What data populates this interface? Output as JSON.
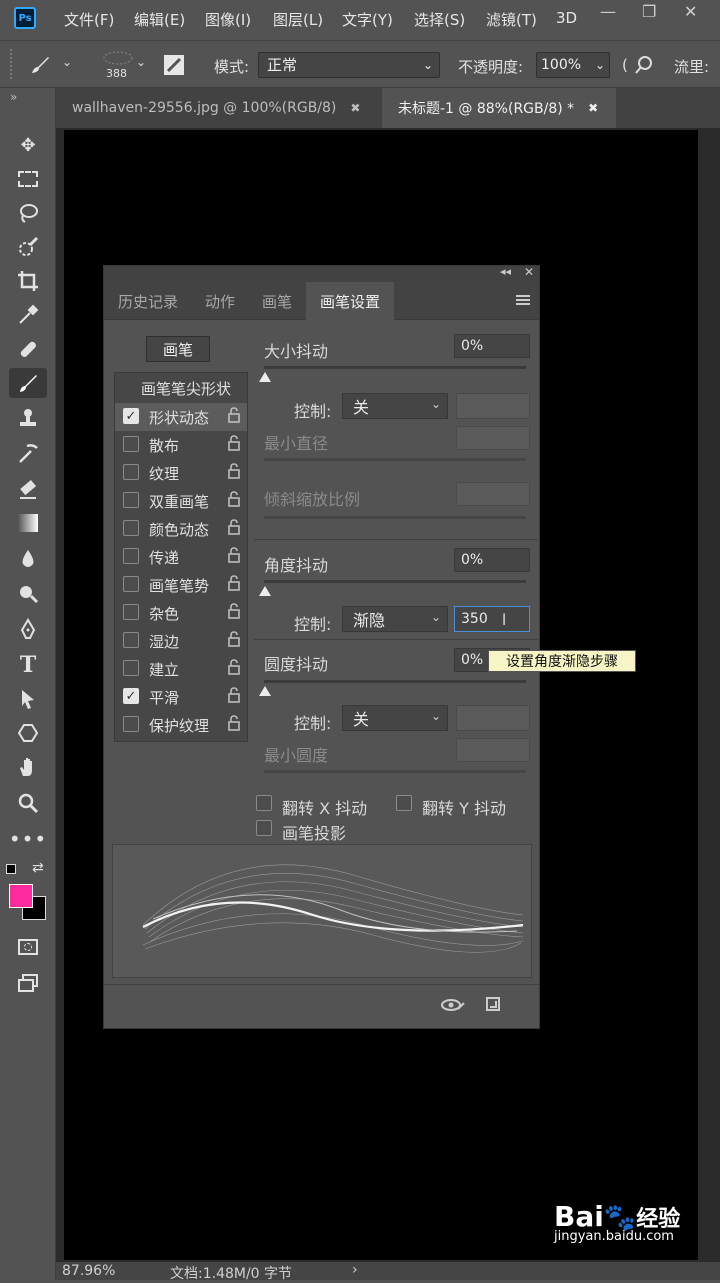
{
  "menubar": {
    "logo": "Ps",
    "items": [
      "文件(F)",
      "编辑(E)",
      "图像(I)",
      "图层(L)",
      "文字(Y)",
      "选择(S)",
      "滤镜(T)",
      "3D"
    ],
    "minimize": "—",
    "restore": "❐",
    "close": "✕"
  },
  "options": {
    "brush_size": "388",
    "mode_label": "模式:",
    "mode_value": "正常",
    "opacity_label": "不透明度:",
    "opacity_value": "100%",
    "flow_label": "流里:"
  },
  "tabs": [
    {
      "label": "wallhaven-29556.jpg @ 100%(RGB/8)",
      "close": "✖"
    },
    {
      "label": "未标题-1 @ 88%(RGB/8) *",
      "close": "✖"
    }
  ],
  "panel": {
    "tabs": [
      "历史记录",
      "动作",
      "画笔",
      "画笔设置"
    ],
    "brush_button": "画笔",
    "tip_shape": "画笔笔尖形状",
    "options": [
      {
        "label": "形状动态",
        "checked": true
      },
      {
        "label": "散布",
        "checked": false
      },
      {
        "label": "纹理",
        "checked": false
      },
      {
        "label": "双重画笔",
        "checked": false
      },
      {
        "label": "颜色动态",
        "checked": false
      },
      {
        "label": "传递",
        "checked": false
      },
      {
        "label": "画笔笔势",
        "checked": false
      },
      {
        "label": "杂色",
        "checked": false
      },
      {
        "label": "湿边",
        "checked": false
      },
      {
        "label": "建立",
        "checked": false
      },
      {
        "label": "平滑",
        "checked": true
      },
      {
        "label": "保护纹理",
        "checked": false
      }
    ],
    "size_jitter_label": "大小抖动",
    "size_jitter_value": "0%",
    "control_label": "控制:",
    "control1_value": "关",
    "min_diameter_label": "最小直径",
    "tilt_scale_label": "倾斜缩放比例",
    "angle_jitter_label": "角度抖动",
    "angle_jitter_value": "0%",
    "control2_value": "渐隐",
    "control2_steps": "350",
    "roundness_jitter_label": "圆度抖动",
    "roundness_jitter_value": "0%",
    "control3_value": "关",
    "min_roundness_label": "最小圆度",
    "flip_x_label": "翻转 X 抖动",
    "flip_y_label": "翻转 Y 抖动",
    "brush_projection_label": "画笔投影",
    "tooltip": "设置角度渐隐步骤",
    "checkmark": "✓"
  },
  "status": {
    "zoom": "87.96%",
    "doc_info": "文档:1.48M/0 字节",
    "arrow": "›"
  },
  "watermark": {
    "logo": "Bai",
    "cn": "经验",
    "url": "jingyan.baidu.com"
  },
  "colors": {
    "foreground": "#ff2aa0",
    "background": "#000000",
    "tooltip_bg": "#f7f5c6"
  }
}
